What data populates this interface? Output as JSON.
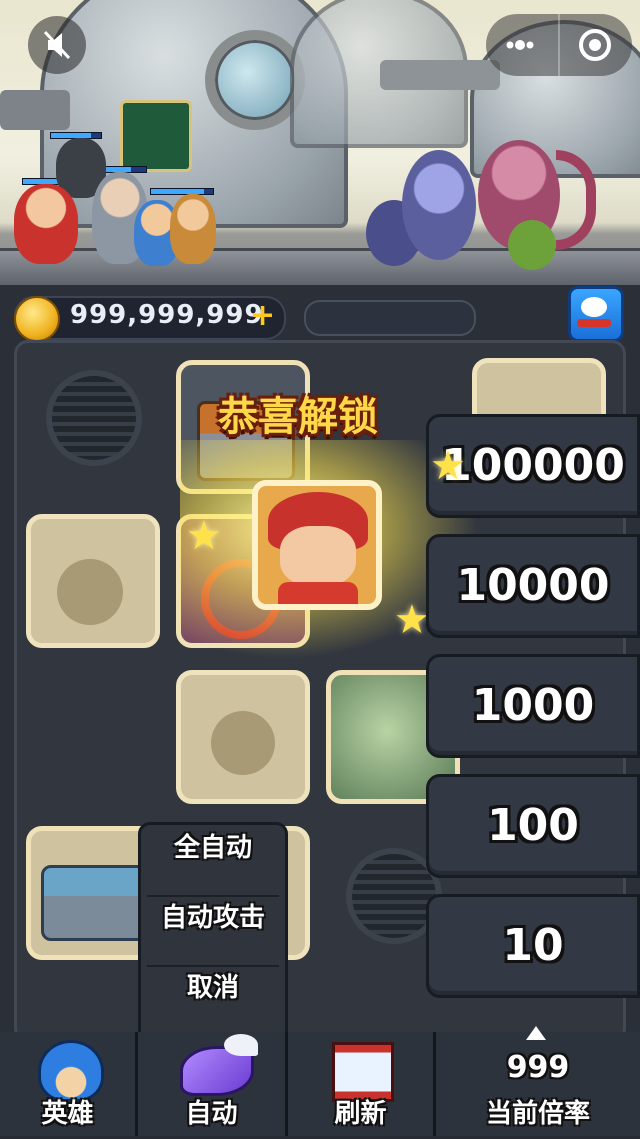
{
  "top": {
    "mute_icon": "speaker-muted-icon",
    "menu_icon": "more-dots-icon",
    "close_icon": "target-close-icon"
  },
  "gold": {
    "amount": "999,999,999",
    "plus": "+"
  },
  "unlock": {
    "title": "恭喜解锁"
  },
  "multiplier_options": [
    "100000",
    "10000",
    "1000",
    "100",
    "10"
  ],
  "auto_menu": {
    "items": [
      "全自动",
      "自动攻击",
      "取消"
    ]
  },
  "bottom_bar": {
    "hero_label": "英雄",
    "auto_label": "自动",
    "refresh_label": "刷新",
    "multiplier_value": "999",
    "multiplier_label": "当前倍率"
  },
  "colors": {
    "gold_text": "#ffd84a",
    "coin": "#f0b21f",
    "panel": "#333944",
    "slot_bg": "#cfc29e",
    "hp_bar": "#3fa8ff"
  }
}
